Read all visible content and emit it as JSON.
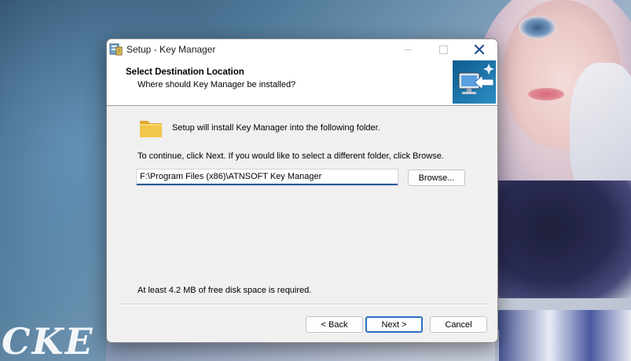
{
  "window": {
    "title": "Setup - Key Manager"
  },
  "header": {
    "title": "Select Destination Location",
    "subtitle": "Where should Key Manager be installed?"
  },
  "body": {
    "intro": "Setup will install Key Manager into the following folder.",
    "instructions": "To continue, click Next. If you would like to select a different folder, click Browse.",
    "path_value": "F:\\Program Files (x86)\\ATNSOFT Key Manager",
    "browse_label": "Browse...",
    "disk_space": "At least 4.2 MB of free disk space is required."
  },
  "buttons": {
    "back": "< Back",
    "next": "Next >",
    "cancel": "Cancel"
  },
  "wallpaper": {
    "text": "CKE"
  },
  "icons": {
    "title": "setup-installer-icon",
    "minimize": "minimize-icon",
    "maximize": "maximize-icon",
    "close": "close-icon",
    "wizard": "computer-install-arrow-icon",
    "folder": "folder-icon"
  },
  "colors": {
    "accent": "#2a6fc4",
    "close_x": "#1f4f8f",
    "dialog_bg": "#f0f0f0",
    "folder": "#f2c64a"
  }
}
